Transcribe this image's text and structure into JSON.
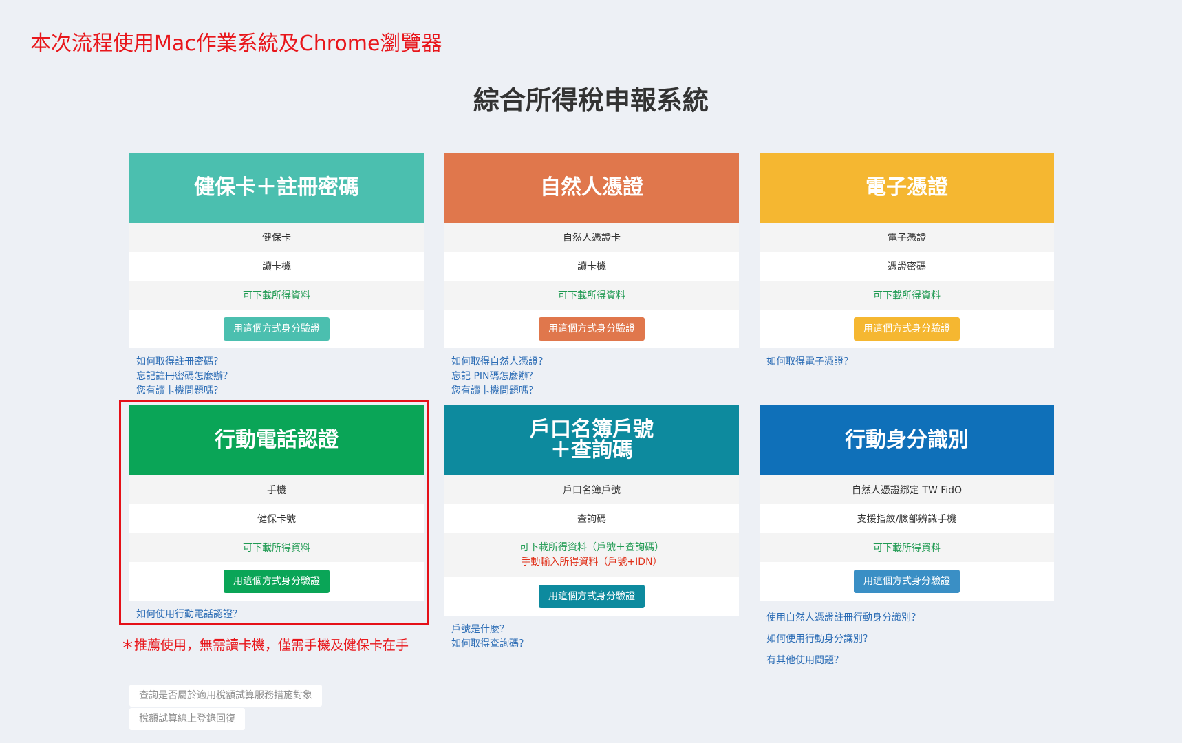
{
  "note": "本次流程使用Mac作業系統及Chrome瀏覽器",
  "page_title": "綜合所得稅申報系統",
  "colors": {
    "card1": "#4bbfaf",
    "card2": "#e0774c",
    "card3": "#f5b731",
    "card4": "#0aa557",
    "card5": "#0d8a9e",
    "card6": "#0f70b9",
    "btn1": "#4bbfaf",
    "btn2": "#e0774c",
    "btn3": "#f5b731",
    "btn4": "#0aa557",
    "btn5": "#0d8a9e",
    "btn6": "#3a8fc5",
    "highlight": "#e51018"
  },
  "cards": [
    {
      "title": "健保卡＋註冊密碼",
      "row1": "健保卡",
      "row2": "讀卡機",
      "row3": "可下載所得資料",
      "button": "用這個方式身分驗證",
      "links": [
        "如何取得註冊密碼？",
        "忘記註冊密碼怎麼辦？",
        "您有讀卡機問題嗎？"
      ]
    },
    {
      "title": "自然人憑證",
      "row1": "自然人憑證卡",
      "row2": "讀卡機",
      "row3": "可下載所得資料",
      "button": "用這個方式身分驗證",
      "links": [
        "如何取得自然人憑證？",
        "忘記 PIN碼怎麼辦？",
        "您有讀卡機問題嗎？"
      ]
    },
    {
      "title": "電子憑證",
      "row1": "電子憑證",
      "row2": "憑證密碼",
      "row3": "可下載所得資料",
      "button": "用這個方式身分驗證",
      "links": [
        "如何取得電子憑證？"
      ]
    },
    {
      "title": "行動電話認證",
      "row1": "手機",
      "row2": "健保卡號",
      "row3": "可下載所得資料",
      "button": "用這個方式身分驗證",
      "links": [
        "如何使用行動電話認證？"
      ]
    },
    {
      "title_line1": "戶口名簿戶號",
      "title_line2": "＋查詢碼",
      "row1": "戶口名簿戶號",
      "row2": "查詢碼",
      "row3a": "可下載所得資料（戶號＋查詢碼）",
      "row3b": "手動輸入所得資料（戶號+IDN）",
      "button": "用這個方式身分驗證",
      "links": [
        "戶號是什麼？",
        "如何取得查詢碼？"
      ]
    },
    {
      "title": "行動身分識別",
      "row1": "自然人憑證綁定 TW FidO",
      "row2": "支援指紋/臉部辨識手機",
      "row3": "可下載所得資料",
      "button": "用這個方式身分驗證",
      "links": [
        "使用自然人憑證註冊行動身分識別？",
        "如何使用行動身分識別？",
        "有其他使用問題？"
      ]
    }
  ],
  "recommend_note": "＊推薦使用，無需讀卡機，僅需手機及健保卡在手",
  "bottom_buttons": [
    "查詢是否屬於適用稅額試算服務措施對象",
    "稅額試算線上登錄回復"
  ]
}
